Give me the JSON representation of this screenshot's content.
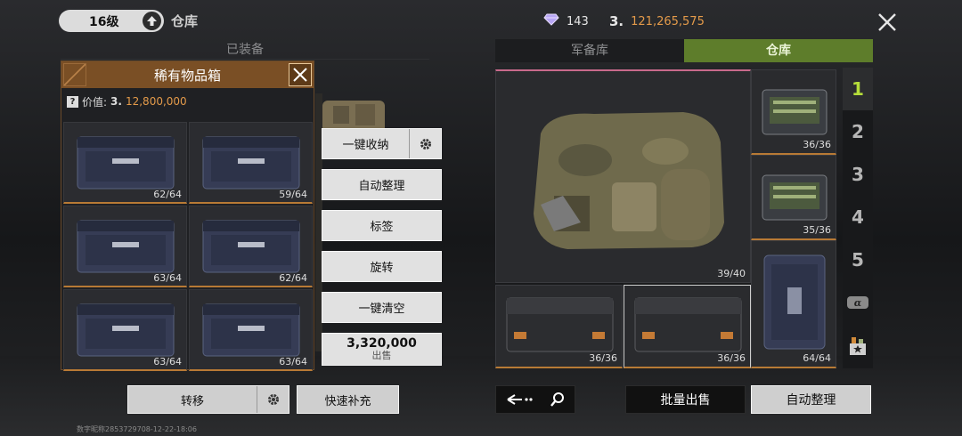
{
  "header": {
    "level": "16级",
    "title": "仓库",
    "diamonds": "143",
    "coins": "121,265,575",
    "close_icon": "close-icon"
  },
  "left_header": "已装备",
  "tabs": [
    {
      "label": "军备库",
      "active": false
    },
    {
      "label": "仓库",
      "active": true
    }
  ],
  "popup": {
    "title": "稀有物品箱",
    "value_label": "价值:",
    "value_symbol": "3.",
    "value": "12,800,000",
    "items": [
      {
        "count": "62/64"
      },
      {
        "count": "59/64"
      },
      {
        "count": "63/64"
      },
      {
        "count": "62/64"
      },
      {
        "count": "63/64"
      },
      {
        "count": "63/64"
      }
    ]
  },
  "actions": {
    "store_all": "一键收纳",
    "auto_sort": "自动整理",
    "tag": "标签",
    "rotate": "旋转",
    "clear_all": "一键清空",
    "sell_price": "3,320,000",
    "sell_label": "出售"
  },
  "bottom_left": {
    "transfer": "转移",
    "quick_refill": "快速补充"
  },
  "bottom_right": {
    "batch_sell": "批量出售",
    "auto_sort": "自动整理"
  },
  "warehouse": {
    "backpack_count": "39/40",
    "side_items": [
      {
        "count": "36/36"
      },
      {
        "count": "35/36"
      },
      {
        "count": "64/64"
      }
    ],
    "bottom_items": [
      {
        "count": "36/36"
      },
      {
        "count": "36/36"
      }
    ]
  },
  "rail": [
    "1",
    "2",
    "3",
    "4",
    "5"
  ],
  "rail_active": "1",
  "footer_id": "数字昵称2853729708-12-22-18:06",
  "colors": {
    "accent_green": "#5e7d2b",
    "rail_active": "#b5dd3a",
    "coin_orange": "#e39a4a",
    "popup_brown": "#7a4f25"
  }
}
